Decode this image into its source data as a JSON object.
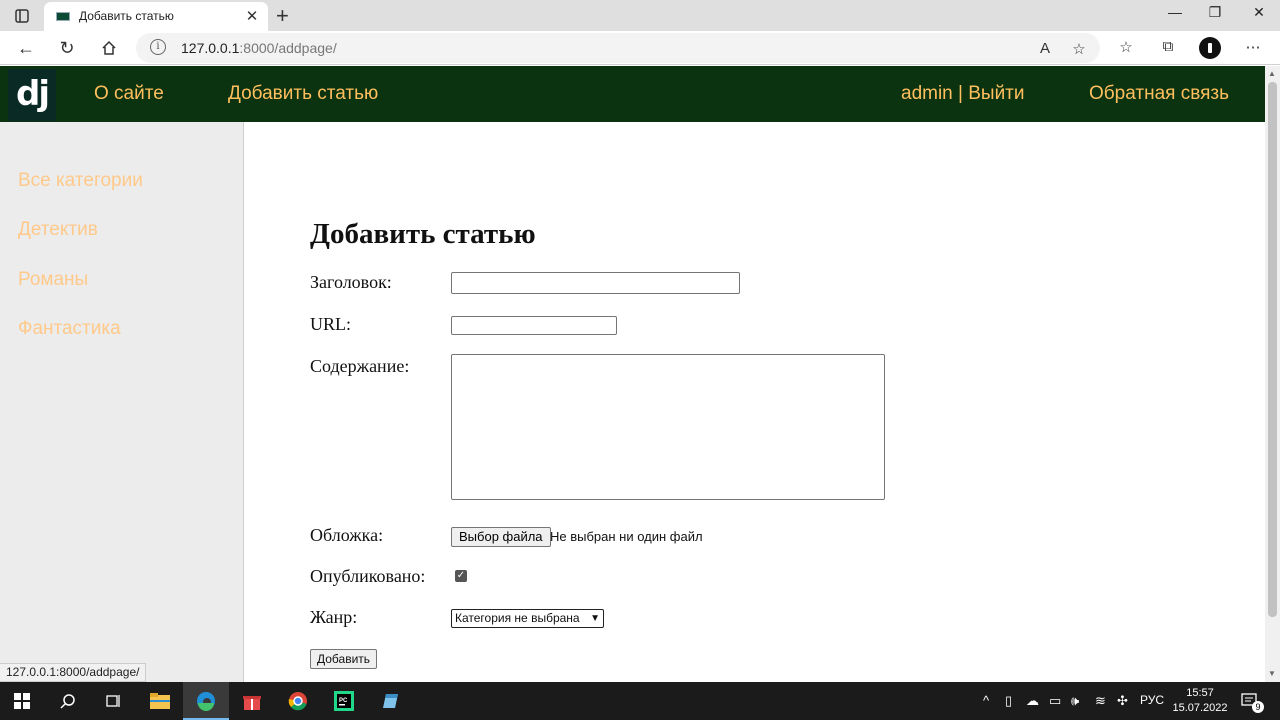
{
  "browser": {
    "tab_title": "Добавить статью",
    "url_host": "127.0.0.1",
    "url_rest": ":8000/addpage/"
  },
  "header": {
    "logo": "dj",
    "nav_about": "О сайте",
    "nav_add": "Добавить статью",
    "user_link": "admin | Выйти",
    "feedback": "Обратная связь"
  },
  "sidebar": {
    "items": [
      {
        "label": "Все категории"
      },
      {
        "label": "Детектив"
      },
      {
        "label": "Романы"
      },
      {
        "label": "Фантастика"
      }
    ]
  },
  "form": {
    "title": "Добавить статью",
    "title_label": "Заголовок:",
    "title_value": "",
    "url_label": "URL:",
    "url_value": "",
    "content_label": "Содержание:",
    "cover_label": "Обложка:",
    "file_button": "Выбор файла",
    "file_status": "Не выбран ни один файл",
    "published_label": "Опубликовано:",
    "published_checked": true,
    "genre_label": "Жанр:",
    "genre_selected": "Категория не выбрана",
    "submit": "Добавить"
  },
  "status_bar": {
    "link": "127.0.0.1:8000/addpage/"
  },
  "taskbar": {
    "lang": "РУС",
    "time": "15:57",
    "date": "15.07.2022",
    "notifications": "9"
  },
  "colors": {
    "header_bg": "#0c330f",
    "nav_text": "#ffbf5e",
    "sidebar_text": "#ffc98a"
  }
}
